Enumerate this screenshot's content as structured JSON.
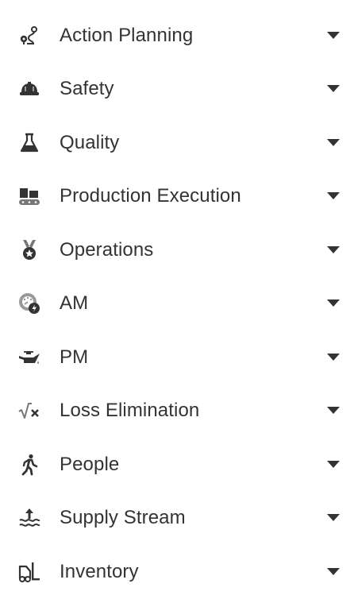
{
  "menu": {
    "items": [
      {
        "label": "Action Planning",
        "icon": "route-icon"
      },
      {
        "label": "Safety",
        "icon": "hard-hat-icon"
      },
      {
        "label": "Quality",
        "icon": "flask-icon"
      },
      {
        "label": "Production Execution",
        "icon": "conveyor-icon"
      },
      {
        "label": "Operations",
        "icon": "medal-icon"
      },
      {
        "label": "AM",
        "icon": "gauge-bolt-icon"
      },
      {
        "label": "PM",
        "icon": "oil-can-icon"
      },
      {
        "label": "Loss Elimination",
        "icon": "square-root-icon"
      },
      {
        "label": "People",
        "icon": "person-walking-icon"
      },
      {
        "label": "Supply Stream",
        "icon": "water-arrow-icon"
      },
      {
        "label": "Inventory",
        "icon": "forklift-icon"
      }
    ]
  },
  "colors": {
    "text": "#333333",
    "icon": "#333333",
    "icon_muted": "#777777",
    "background": "#ffffff"
  }
}
